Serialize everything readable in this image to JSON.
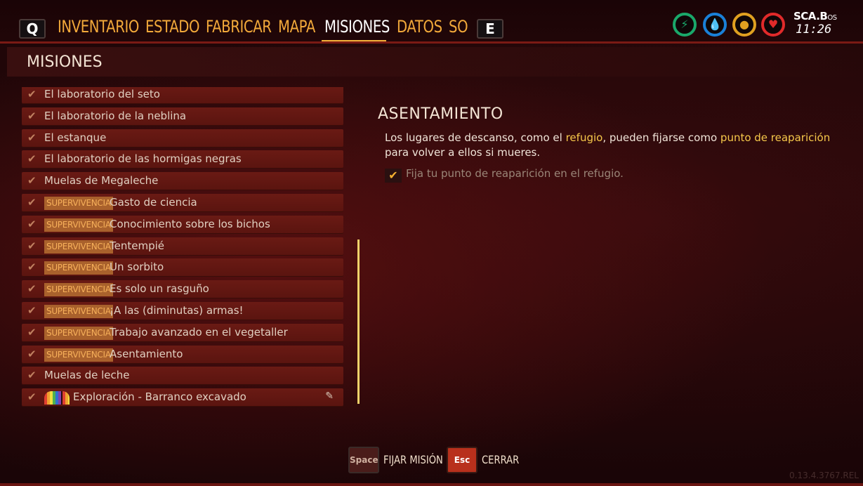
{
  "nav": {
    "left_key": "Q",
    "right_key": "E",
    "tabs": [
      "INVENTARIO",
      "ESTADO",
      "FABRICAR",
      "MAPA",
      "MISIONES",
      "DATOS",
      "SO"
    ],
    "active_tab": "MISIONES"
  },
  "stats": [
    {
      "icon": "stamina-icon",
      "glyph": "⚡",
      "color": "#1aa86a"
    },
    {
      "icon": "water-icon",
      "glyph": "💧",
      "color": "#1a80d8"
    },
    {
      "icon": "food-icon",
      "glyph": "●",
      "color": "#e0a020"
    },
    {
      "icon": "health-icon",
      "glyph": "♥",
      "color": "#e02a2a"
    }
  ],
  "clock": {
    "label": "SCA.B",
    "suffix": "OS",
    "time": "11:26"
  },
  "section_title": "MISIONES",
  "quests": [
    {
      "label": "El laboratorio del seto",
      "tag": ""
    },
    {
      "label": "El laboratorio de la neblina",
      "tag": ""
    },
    {
      "label": "El estanque",
      "tag": ""
    },
    {
      "label": "El laboratorio de las hormigas negras",
      "tag": ""
    },
    {
      "label": "Muelas de Megaleche",
      "tag": ""
    },
    {
      "label": "Gasto de ciencia",
      "tag": "SUPERVIVENCIA"
    },
    {
      "label": "Conocimiento sobre los bichos",
      "tag": "SUPERVIVENCIA"
    },
    {
      "label": "Tentempié",
      "tag": "SUPERVIVENCIA"
    },
    {
      "label": "Un sorbito",
      "tag": "SUPERVIVENCIA"
    },
    {
      "label": "Es solo un rasguño",
      "tag": "SUPERVIVENCIA"
    },
    {
      "label": "¡A las (diminutas) armas!",
      "tag": "SUPERVIVENCIA"
    },
    {
      "label": "Trabajo avanzado en el vegetaller",
      "tag": "SUPERVIVENCIA"
    },
    {
      "label": "Asentamiento",
      "tag": "SUPERVIVENCIA"
    },
    {
      "label": "Muelas de leche",
      "tag": ""
    },
    {
      "label": "Exploración - Barranco excavado",
      "tag": "",
      "rainbow": true,
      "pinned": true
    }
  ],
  "detail": {
    "title": "ASENTAMIENTO",
    "text_1": "Los lugares de descanso, como el ",
    "highlight_1": "refugio",
    "text_2": ", pueden fijarse como ",
    "highlight_2": "punto de reaparición",
    "text_3": "para volver a ellos si mueres.",
    "objective": "Fija tu punto de reaparición en el refugio."
  },
  "footer": {
    "pin_key": "Space",
    "pin_label": "FIJAR MISIÓN",
    "close_key": "Esc",
    "close_label": "CERRAR"
  },
  "version": "0.13.4.3767.REL"
}
